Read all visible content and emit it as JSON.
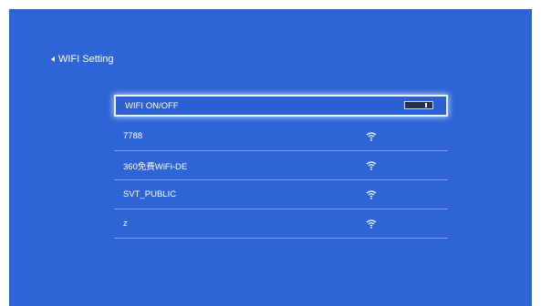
{
  "header": {
    "back_label": "WIFI Setting"
  },
  "wifi_toggle": {
    "label": "WIFI ON/OFF",
    "state": "on"
  },
  "networks": [
    {
      "ssid": "7788",
      "icon": "wifi-icon"
    },
    {
      "ssid": "360免费WiFi-DE",
      "icon": "wifi-icon"
    },
    {
      "ssid": "SVT_PUBLIC",
      "icon": "wifi-icon"
    },
    {
      "ssid": "z",
      "icon": "wifi-icon"
    }
  ],
  "colors": {
    "background": "#2f64d6",
    "text": "#ffffff",
    "focus_border": "#e8f1ff"
  }
}
